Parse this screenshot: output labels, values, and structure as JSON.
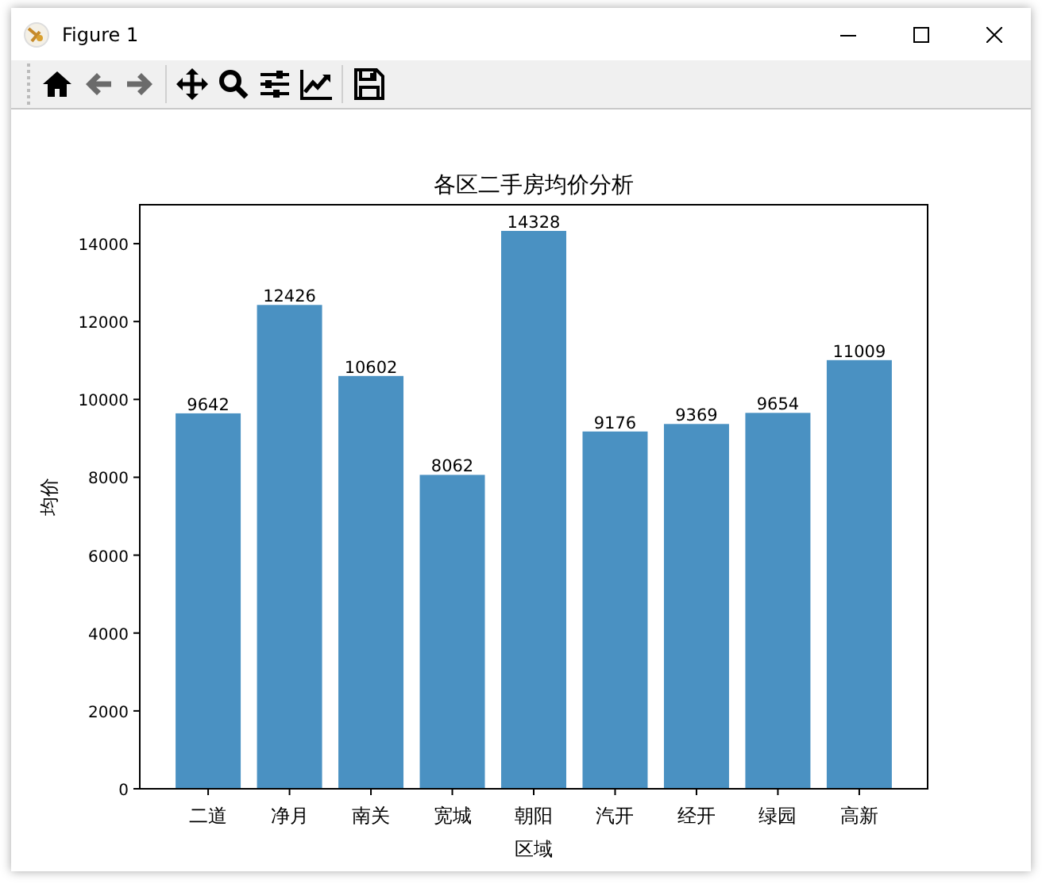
{
  "window": {
    "title": "Figure 1"
  },
  "toolbar": [
    {
      "kind": "home",
      "disabled": false
    },
    {
      "kind": "back",
      "disabled": true
    },
    {
      "kind": "forward",
      "disabled": true
    },
    {
      "kind": "pan",
      "disabled": false
    },
    {
      "kind": "zoom",
      "disabled": false
    },
    {
      "kind": "subplots",
      "disabled": false
    },
    {
      "kind": "axes",
      "disabled": false
    },
    {
      "kind": "save",
      "disabled": false
    }
  ],
  "figure": {
    "chart_data": {
      "type": "bar",
      "title": "各区二手房均价分析",
      "xlabel": "区域",
      "ylabel": "均价",
      "categories": [
        "二道",
        "净月",
        "南关",
        "宽城",
        "朝阳",
        "汽开",
        "经开",
        "绿园",
        "高新"
      ],
      "series": [
        {
          "color": "#4a91c2",
          "values": [
            9642,
            12426,
            10602,
            8062,
            14328,
            9176,
            9369,
            9654,
            11009
          ]
        }
      ],
      "ylim": [
        0,
        15000
      ],
      "yticks": [
        0,
        2000,
        4000,
        6000,
        8000,
        10000,
        12000,
        14000
      ],
      "data_labels": true
    }
  }
}
